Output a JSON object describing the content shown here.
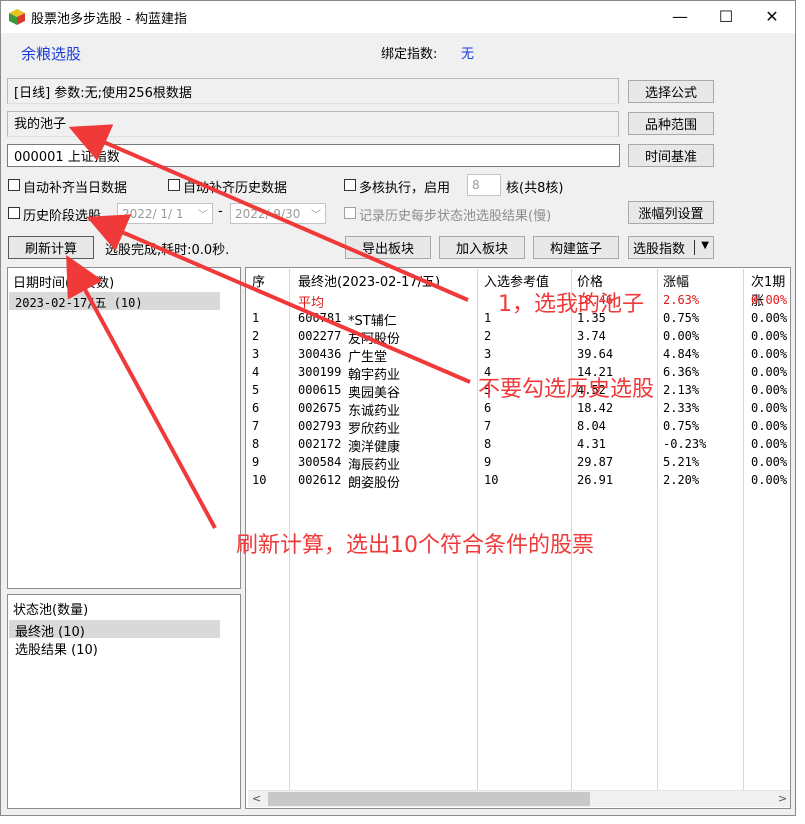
{
  "window": {
    "title": "股票池多步选股 - 构蓝建指",
    "controls": {
      "minimize": "—",
      "maximize": "☐",
      "close": "✕"
    }
  },
  "header": {
    "selector_name": "余粮选股",
    "bind_index_label": "绑定指数:",
    "bind_index_value": "无"
  },
  "params_text": "[日线] 参数:无;使用256根数据",
  "pool_name": "我的池子",
  "index_code": "000001 上证指数",
  "buttons": {
    "select_formula": "选择公式",
    "variety_range": "品种范围",
    "time_base": "时间基准",
    "change_col_settings": "涨幅列设置",
    "refresh": "刷新计算",
    "export_block": "导出板块",
    "add_block": "加入板块",
    "build_basket": "构建篮子",
    "pick_index": "选股指数"
  },
  "options": {
    "auto_fill_today": {
      "label": "自动补齐当日数据",
      "checked": false
    },
    "auto_fill_history": {
      "label": "自动补齐历史数据",
      "checked": false
    },
    "multicore": {
      "label": "多核执行，启用",
      "checked": false,
      "cores": "8",
      "suffix": "核(共8核)"
    },
    "history_stage": {
      "label": "历史阶段选股",
      "checked": false,
      "start_date": "2022/ 1/ 1",
      "dash": "-",
      "end_date": "2022/ 9/30"
    },
    "record_history": {
      "label": "记录历史每步状态池选股结果(慢)",
      "checked": false
    }
  },
  "status_text": "选股完成,耗时:0.0秒.",
  "date_panel": {
    "header": "日期时间(最终数)",
    "rows": [
      "2023-02-17/五 (10)"
    ]
  },
  "state_panel": {
    "header": "状态池(数量)",
    "rows": [
      "最终池 (10)",
      "选股结果 (10)"
    ]
  },
  "grid": {
    "columns": [
      "序",
      "最终池(2023-02-17/五)",
      "入选参考值",
      "价格",
      "涨幅",
      "次1期涨"
    ],
    "avg_row": {
      "label": "平均",
      "price": "18.46",
      "change": "2.63%",
      "next": "0.00%"
    },
    "rows": [
      {
        "no": "1",
        "code": "600781",
        "name": "*ST辅仁",
        "ref": "1",
        "price": "1.35",
        "change": "0.75%",
        "next": "0.00%"
      },
      {
        "no": "2",
        "code": "002277",
        "name": "友阿股份",
        "ref": "2",
        "price": "3.74",
        "change": "0.00%",
        "next": "0.00%"
      },
      {
        "no": "3",
        "code": "300436",
        "name": "广生堂",
        "ref": "3",
        "price": "39.64",
        "change": "4.84%",
        "next": "0.00%"
      },
      {
        "no": "4",
        "code": "300199",
        "name": "翰宇药业",
        "ref": "4",
        "price": "14.21",
        "change": "6.36%",
        "next": "0.00%"
      },
      {
        "no": "5",
        "code": "000615",
        "name": "奥园美谷",
        "ref": "5",
        "price": "4.52",
        "change": "2.13%",
        "next": "0.00%"
      },
      {
        "no": "6",
        "code": "002675",
        "name": "东诚药业",
        "ref": "6",
        "price": "18.42",
        "change": "2.33%",
        "next": "0.00%"
      },
      {
        "no": "7",
        "code": "002793",
        "name": "罗欣药业",
        "ref": "7",
        "price": "8.04",
        "change": "0.75%",
        "next": "0.00%"
      },
      {
        "no": "8",
        "code": "002172",
        "name": "澳洋健康",
        "ref": "8",
        "price": "4.31",
        "change": "-0.23%",
        "next": "0.00%"
      },
      {
        "no": "9",
        "code": "300584",
        "name": "海辰药业",
        "ref": "9",
        "price": "29.87",
        "change": "5.21%",
        "next": "0.00%"
      },
      {
        "no": "10",
        "code": "002612",
        "name": "朗姿股份",
        "ref": "10",
        "price": "26.91",
        "change": "2.20%",
        "next": "0.00%"
      }
    ]
  },
  "annotations": {
    "pick_pool": "1，选我的池子",
    "no_history": "不要勾选历史选股",
    "refresh_hint": "刷新计算，选出10个符合条件的股票"
  },
  "colors": {
    "accent_blue": "#1a3bd8",
    "annotation_red": "#f03a3a",
    "up_red": "#e01818"
  }
}
